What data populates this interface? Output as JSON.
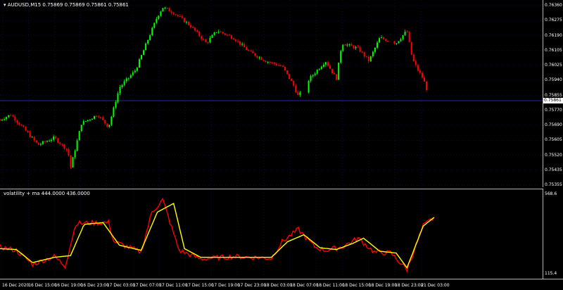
{
  "chart_title": "AUDUSD,M15  0.75869 0.75869 0.75861 0.75861",
  "indicator_title": "volatility + ma 444.0000 436.0000",
  "current_price": "0.75861",
  "price_ticks": [
    "0.76360",
    "0.76275",
    "0.76190",
    "0.76105",
    "0.76025",
    "0.75940",
    "0.75855",
    "0.75770",
    "0.75690",
    "0.75605",
    "0.75520",
    "0.75435",
    "0.75355"
  ],
  "indicator_ticks": [
    "568.6",
    "115.4"
  ],
  "time_ticks": [
    "16 Dec 2020",
    "16 Dec 15:00",
    "16 Dec 19:00",
    "16 Dec 23:00",
    "17 Dec 03:00",
    "17 Dec 07:00",
    "17 Dec 11:00",
    "17 Dec 15:00",
    "17 Dec 19:00",
    "17 Dec 23:00",
    "18 Dec 03:00",
    "18 Dec 07:00",
    "18 Dec 11:00",
    "18 Dec 15:00",
    "18 Dec 19:00",
    "18 Dec 23:00",
    "21 Dec 03:00"
  ],
  "colors": {
    "bull": "#00ff00",
    "bear": "#ff0000",
    "grid": "#1a1a5a",
    "price_line": "#2828a0",
    "volatility": "#ff0000",
    "ma": "#ffff00",
    "axis": "#b4b4b4"
  },
  "chart_data": {
    "type": "line",
    "price_ylim": [
      0.75355,
      0.7636
    ],
    "price_path": [
      [
        0,
        0.7572
      ],
      [
        0.02,
        0.7575
      ],
      [
        0.05,
        0.7565
      ],
      [
        0.07,
        0.7558
      ],
      [
        0.1,
        0.7562
      ],
      [
        0.125,
        0.7555
      ],
      [
        0.13,
        0.7545
      ],
      [
        0.15,
        0.757
      ],
      [
        0.18,
        0.7575
      ],
      [
        0.2,
        0.7568
      ],
      [
        0.22,
        0.759
      ],
      [
        0.25,
        0.76
      ],
      [
        0.27,
        0.7615
      ],
      [
        0.29,
        0.763
      ],
      [
        0.3,
        0.7635
      ],
      [
        0.32,
        0.7632
      ],
      [
        0.35,
        0.7625
      ],
      [
        0.38,
        0.7615
      ],
      [
        0.4,
        0.7622
      ],
      [
        0.43,
        0.7618
      ],
      [
        0.46,
        0.761
      ],
      [
        0.49,
        0.7605
      ],
      [
        0.52,
        0.7602
      ],
      [
        0.54,
        0.7592
      ],
      [
        0.55,
        0.7585
      ],
      [
        0.57,
        0.7595
      ],
      [
        0.6,
        0.7605
      ],
      [
        0.62,
        0.7595
      ],
      [
        0.63,
        0.7615
      ],
      [
        0.66,
        0.7612
      ],
      [
        0.68,
        0.7605
      ],
      [
        0.7,
        0.7618
      ],
      [
        0.73,
        0.7615
      ],
      [
        0.75,
        0.7622
      ],
      [
        0.76,
        0.7606
      ],
      [
        0.77,
        0.76
      ],
      [
        0.78,
        0.7595
      ],
      [
        0.79,
        0.7586
      ]
    ],
    "indicator_ylim": [
      115.4,
      568.6
    ],
    "volatility": [
      [
        0,
        270
      ],
      [
        0.03,
        250
      ],
      [
        0.06,
        170
      ],
      [
        0.1,
        215
      ],
      [
        0.12,
        160
      ],
      [
        0.14,
        405
      ],
      [
        0.2,
        410
      ],
      [
        0.21,
        300
      ],
      [
        0.26,
        240
      ],
      [
        0.28,
        470
      ],
      [
        0.3,
        540
      ],
      [
        0.33,
        250
      ],
      [
        0.37,
        200
      ],
      [
        0.43,
        215
      ],
      [
        0.5,
        205
      ],
      [
        0.52,
        300
      ],
      [
        0.55,
        370
      ],
      [
        0.58,
        270
      ],
      [
        0.6,
        250
      ],
      [
        0.63,
        270
      ],
      [
        0.66,
        320
      ],
      [
        0.69,
        240
      ],
      [
        0.72,
        235
      ],
      [
        0.75,
        140
      ],
      [
        0.78,
        390
      ],
      [
        0.8,
        440
      ]
    ],
    "ma": [
      [
        0,
        260
      ],
      [
        0.03,
        255
      ],
      [
        0.06,
        180
      ],
      [
        0.1,
        210
      ],
      [
        0.13,
        220
      ],
      [
        0.155,
        400
      ],
      [
        0.19,
        410
      ],
      [
        0.22,
        280
      ],
      [
        0.26,
        250
      ],
      [
        0.29,
        470
      ],
      [
        0.32,
        520
      ],
      [
        0.34,
        260
      ],
      [
        0.37,
        210
      ],
      [
        0.43,
        210
      ],
      [
        0.5,
        210
      ],
      [
        0.53,
        300
      ],
      [
        0.56,
        340
      ],
      [
        0.59,
        265
      ],
      [
        0.62,
        255
      ],
      [
        0.65,
        290
      ],
      [
        0.67,
        320
      ],
      [
        0.7,
        245
      ],
      [
        0.73,
        235
      ],
      [
        0.75,
        150
      ],
      [
        0.78,
        390
      ],
      [
        0.8,
        440
      ]
    ]
  }
}
